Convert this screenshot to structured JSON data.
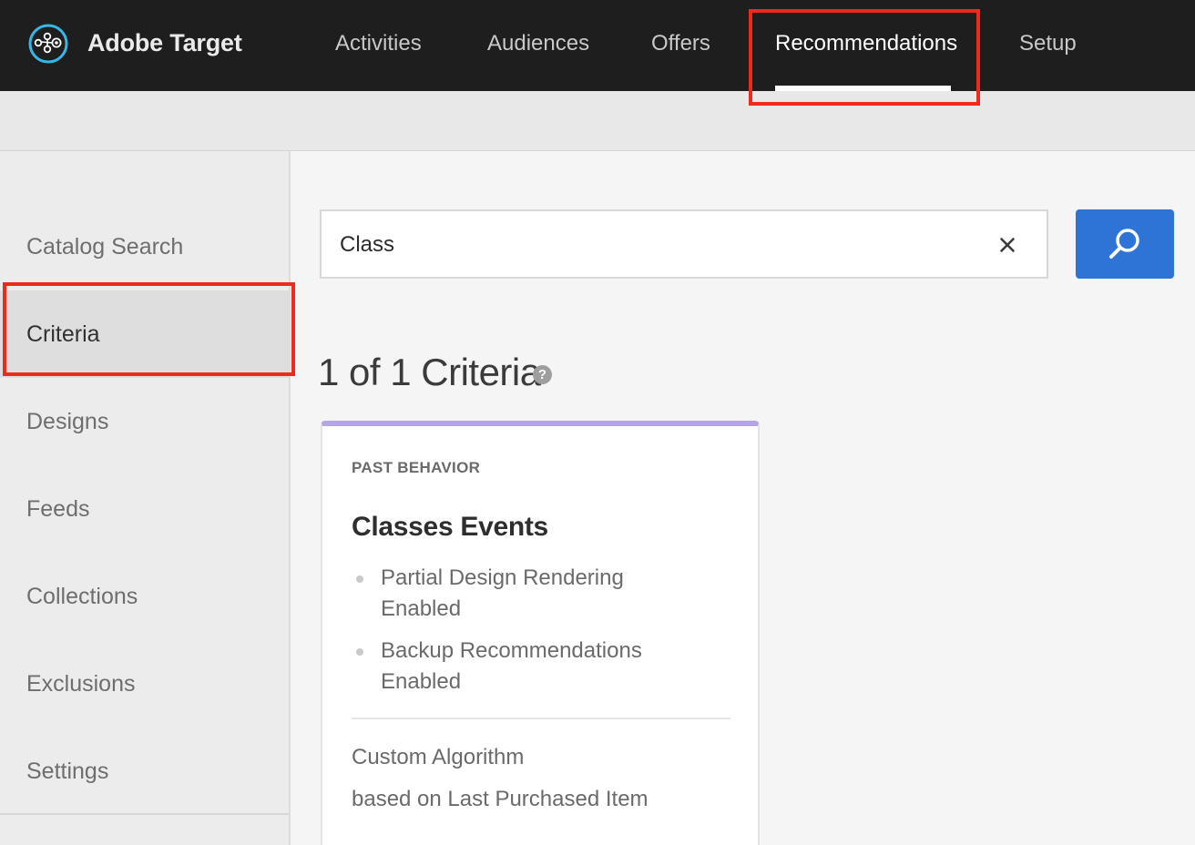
{
  "app": {
    "name": "Adobe Target",
    "logo_icon": "adobe-target-logo-icon"
  },
  "nav": {
    "items": [
      {
        "label": "Activities"
      },
      {
        "label": "Audiences"
      },
      {
        "label": "Offers"
      },
      {
        "label": "Recommendations",
        "active": true
      },
      {
        "label": "Setup"
      }
    ]
  },
  "sidebar": {
    "items": [
      {
        "label": "Catalog Search"
      },
      {
        "label": "Criteria",
        "active": true
      },
      {
        "label": "Designs"
      },
      {
        "label": "Feeds"
      },
      {
        "label": "Collections"
      },
      {
        "label": "Exclusions"
      },
      {
        "label": "Settings"
      }
    ]
  },
  "search": {
    "value": "Class",
    "clear_icon": "close-icon",
    "button_icon": "search-icon"
  },
  "results": {
    "heading": "1 of 1 Criteria",
    "help_glyph": "?"
  },
  "card": {
    "category": "PAST BEHAVIOR",
    "title": "Classes Events",
    "bullets": [
      "Partial Design Rendering Enabled",
      "Backup Recommendations Enabled"
    ],
    "algorithm": "Custom Algorithm",
    "based_on": "based on Last Purchased Item",
    "accent_color": "#b3a5e6"
  },
  "colors": {
    "topbar": "#1e1e1e",
    "primary_button": "#2d74d6",
    "highlight": "#ef2a1d"
  }
}
